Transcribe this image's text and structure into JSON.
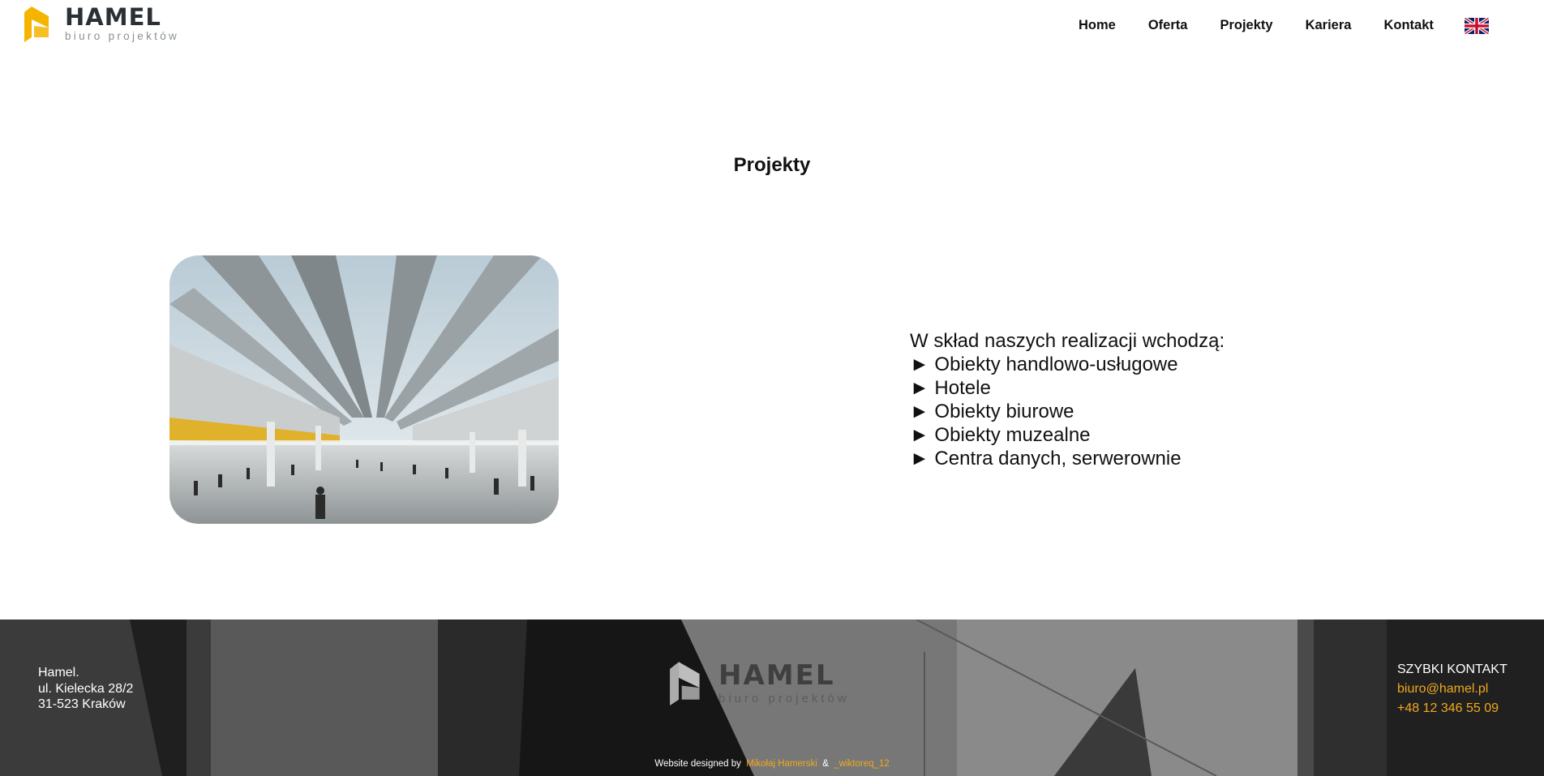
{
  "header": {
    "logo": {
      "name": "HAMEL",
      "tagline": "biuro projektów"
    },
    "nav": [
      {
        "label": "Home"
      },
      {
        "label": "Oferta"
      },
      {
        "label": "Projekty"
      },
      {
        "label": "Kariera"
      },
      {
        "label": "Kontakt"
      }
    ],
    "language_icon": "uk-flag-icon"
  },
  "main": {
    "title": "Projekty",
    "image_icon": "project-photo-shopping-hall",
    "intro": "W skład naszych realizacji wchodzą:",
    "items": [
      "► Obiekty handlowo-usługowe",
      "► Hotele",
      "► Obiekty biurowe",
      "► Obiekty muzealne",
      "► Centra danych, serwerownie"
    ]
  },
  "footer": {
    "address": [
      "Hamel.",
      "ul. Kielecka 28/2",
      "31-523 Kraków"
    ],
    "logo": {
      "name": "HAMEL",
      "tagline": "biuro projektów"
    },
    "contact": {
      "heading": "SZYBKI KONTAKT",
      "email": "biuro@hamel.pl",
      "phone": "+48 12 346 55 09"
    },
    "credit": {
      "prefix": "Website designed by",
      "author1": "Mikołaj Hamerski",
      "separator": "&",
      "author2": "_wiktoreq_12"
    }
  },
  "colors": {
    "accent": "#f0a81e",
    "logo_yellow": "#f5b400",
    "text": "#111111",
    "footer_bg": "#2b2b2b"
  }
}
